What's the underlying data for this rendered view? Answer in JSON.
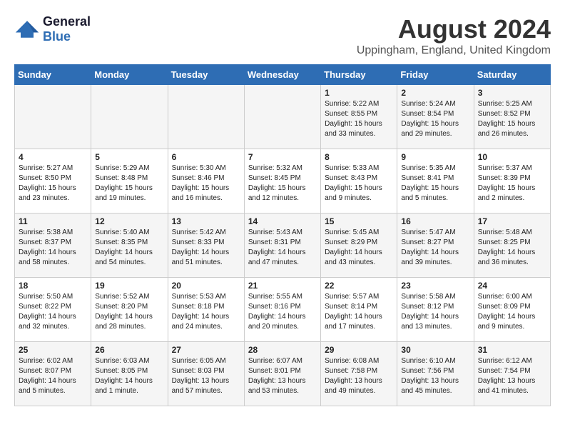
{
  "header": {
    "logo_general": "General",
    "logo_blue": "Blue",
    "title": "August 2024",
    "subtitle": "Uppingham, England, United Kingdom"
  },
  "weekdays": [
    "Sunday",
    "Monday",
    "Tuesday",
    "Wednesday",
    "Thursday",
    "Friday",
    "Saturday"
  ],
  "weeks": [
    [
      {
        "day": "",
        "sunrise": "",
        "sunset": "",
        "daylight": ""
      },
      {
        "day": "",
        "sunrise": "",
        "sunset": "",
        "daylight": ""
      },
      {
        "day": "",
        "sunrise": "",
        "sunset": "",
        "daylight": ""
      },
      {
        "day": "",
        "sunrise": "",
        "sunset": "",
        "daylight": ""
      },
      {
        "day": "1",
        "sunrise": "Sunrise: 5:22 AM",
        "sunset": "Sunset: 8:55 PM",
        "daylight": "Daylight: 15 hours and 33 minutes."
      },
      {
        "day": "2",
        "sunrise": "Sunrise: 5:24 AM",
        "sunset": "Sunset: 8:54 PM",
        "daylight": "Daylight: 15 hours and 29 minutes."
      },
      {
        "day": "3",
        "sunrise": "Sunrise: 5:25 AM",
        "sunset": "Sunset: 8:52 PM",
        "daylight": "Daylight: 15 hours and 26 minutes."
      }
    ],
    [
      {
        "day": "4",
        "sunrise": "Sunrise: 5:27 AM",
        "sunset": "Sunset: 8:50 PM",
        "daylight": "Daylight: 15 hours and 23 minutes."
      },
      {
        "day": "5",
        "sunrise": "Sunrise: 5:29 AM",
        "sunset": "Sunset: 8:48 PM",
        "daylight": "Daylight: 15 hours and 19 minutes."
      },
      {
        "day": "6",
        "sunrise": "Sunrise: 5:30 AM",
        "sunset": "Sunset: 8:46 PM",
        "daylight": "Daylight: 15 hours and 16 minutes."
      },
      {
        "day": "7",
        "sunrise": "Sunrise: 5:32 AM",
        "sunset": "Sunset: 8:45 PM",
        "daylight": "Daylight: 15 hours and 12 minutes."
      },
      {
        "day": "8",
        "sunrise": "Sunrise: 5:33 AM",
        "sunset": "Sunset: 8:43 PM",
        "daylight": "Daylight: 15 hours and 9 minutes."
      },
      {
        "day": "9",
        "sunrise": "Sunrise: 5:35 AM",
        "sunset": "Sunset: 8:41 PM",
        "daylight": "Daylight: 15 hours and 5 minutes."
      },
      {
        "day": "10",
        "sunrise": "Sunrise: 5:37 AM",
        "sunset": "Sunset: 8:39 PM",
        "daylight": "Daylight: 15 hours and 2 minutes."
      }
    ],
    [
      {
        "day": "11",
        "sunrise": "Sunrise: 5:38 AM",
        "sunset": "Sunset: 8:37 PM",
        "daylight": "Daylight: 14 hours and 58 minutes."
      },
      {
        "day": "12",
        "sunrise": "Sunrise: 5:40 AM",
        "sunset": "Sunset: 8:35 PM",
        "daylight": "Daylight: 14 hours and 54 minutes."
      },
      {
        "day": "13",
        "sunrise": "Sunrise: 5:42 AM",
        "sunset": "Sunset: 8:33 PM",
        "daylight": "Daylight: 14 hours and 51 minutes."
      },
      {
        "day": "14",
        "sunrise": "Sunrise: 5:43 AM",
        "sunset": "Sunset: 8:31 PM",
        "daylight": "Daylight: 14 hours and 47 minutes."
      },
      {
        "day": "15",
        "sunrise": "Sunrise: 5:45 AM",
        "sunset": "Sunset: 8:29 PM",
        "daylight": "Daylight: 14 hours and 43 minutes."
      },
      {
        "day": "16",
        "sunrise": "Sunrise: 5:47 AM",
        "sunset": "Sunset: 8:27 PM",
        "daylight": "Daylight: 14 hours and 39 minutes."
      },
      {
        "day": "17",
        "sunrise": "Sunrise: 5:48 AM",
        "sunset": "Sunset: 8:25 PM",
        "daylight": "Daylight: 14 hours and 36 minutes."
      }
    ],
    [
      {
        "day": "18",
        "sunrise": "Sunrise: 5:50 AM",
        "sunset": "Sunset: 8:22 PM",
        "daylight": "Daylight: 14 hours and 32 minutes."
      },
      {
        "day": "19",
        "sunrise": "Sunrise: 5:52 AM",
        "sunset": "Sunset: 8:20 PM",
        "daylight": "Daylight: 14 hours and 28 minutes."
      },
      {
        "day": "20",
        "sunrise": "Sunrise: 5:53 AM",
        "sunset": "Sunset: 8:18 PM",
        "daylight": "Daylight: 14 hours and 24 minutes."
      },
      {
        "day": "21",
        "sunrise": "Sunrise: 5:55 AM",
        "sunset": "Sunset: 8:16 PM",
        "daylight": "Daylight: 14 hours and 20 minutes."
      },
      {
        "day": "22",
        "sunrise": "Sunrise: 5:57 AM",
        "sunset": "Sunset: 8:14 PM",
        "daylight": "Daylight: 14 hours and 17 minutes."
      },
      {
        "day": "23",
        "sunrise": "Sunrise: 5:58 AM",
        "sunset": "Sunset: 8:12 PM",
        "daylight": "Daylight: 14 hours and 13 minutes."
      },
      {
        "day": "24",
        "sunrise": "Sunrise: 6:00 AM",
        "sunset": "Sunset: 8:09 PM",
        "daylight": "Daylight: 14 hours and 9 minutes."
      }
    ],
    [
      {
        "day": "25",
        "sunrise": "Sunrise: 6:02 AM",
        "sunset": "Sunset: 8:07 PM",
        "daylight": "Daylight: 14 hours and 5 minutes."
      },
      {
        "day": "26",
        "sunrise": "Sunrise: 6:03 AM",
        "sunset": "Sunset: 8:05 PM",
        "daylight": "Daylight: 14 hours and 1 minute."
      },
      {
        "day": "27",
        "sunrise": "Sunrise: 6:05 AM",
        "sunset": "Sunset: 8:03 PM",
        "daylight": "Daylight: 13 hours and 57 minutes."
      },
      {
        "day": "28",
        "sunrise": "Sunrise: 6:07 AM",
        "sunset": "Sunset: 8:01 PM",
        "daylight": "Daylight: 13 hours and 53 minutes."
      },
      {
        "day": "29",
        "sunrise": "Sunrise: 6:08 AM",
        "sunset": "Sunset: 7:58 PM",
        "daylight": "Daylight: 13 hours and 49 minutes."
      },
      {
        "day": "30",
        "sunrise": "Sunrise: 6:10 AM",
        "sunset": "Sunset: 7:56 PM",
        "daylight": "Daylight: 13 hours and 45 minutes."
      },
      {
        "day": "31",
        "sunrise": "Sunrise: 6:12 AM",
        "sunset": "Sunset: 7:54 PM",
        "daylight": "Daylight: 13 hours and 41 minutes."
      }
    ]
  ]
}
